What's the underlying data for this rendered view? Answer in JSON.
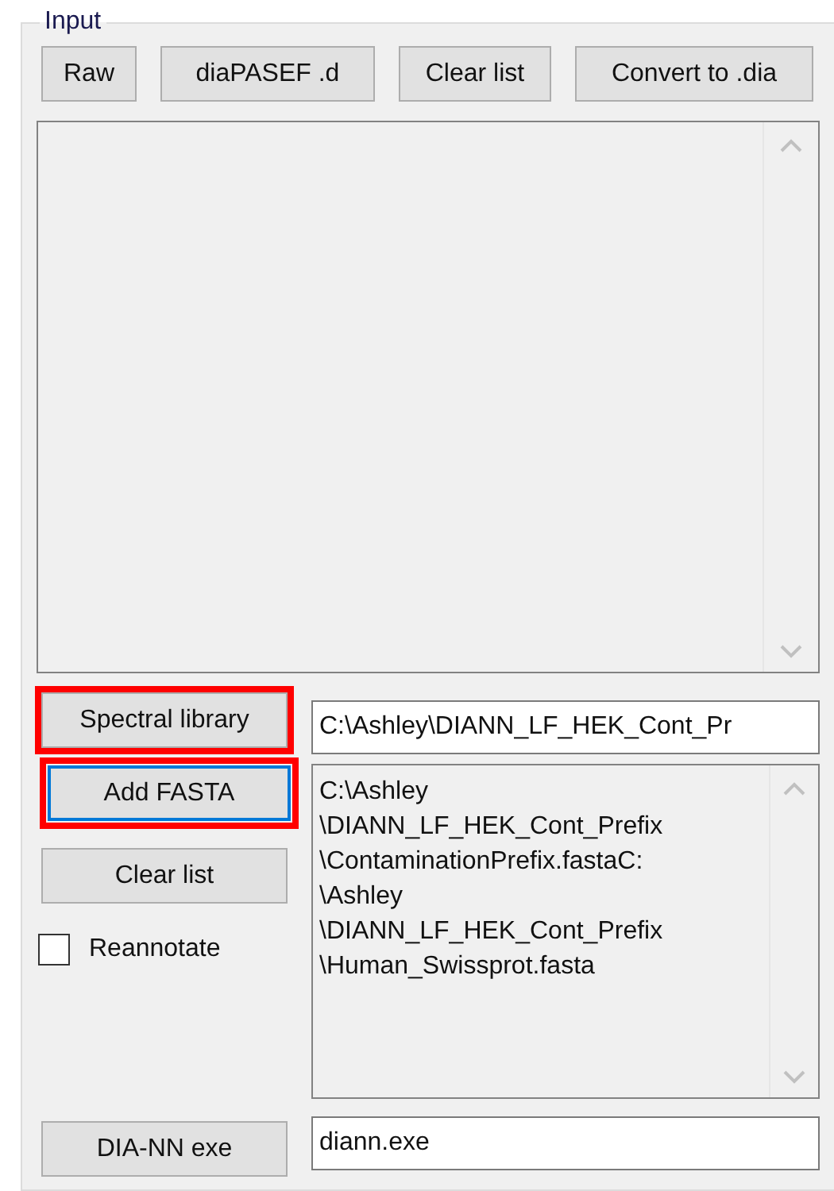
{
  "group": {
    "title": "Input"
  },
  "toolbar_buttons": [
    {
      "label": "Raw"
    },
    {
      "label": "diaPASEF .d"
    },
    {
      "label": "Clear list"
    },
    {
      "label": "Convert to .dia"
    }
  ],
  "spectral_library": {
    "button": {
      "label": "Spectral library",
      "highlighted": true,
      "focused": false
    },
    "path": "C:\\Ashley\\DIANN_LF_HEK_Cont_Pr"
  },
  "fasta": {
    "add_button": {
      "label": "Add FASTA",
      "highlighted": true,
      "focused": true
    },
    "clear_button": {
      "label": "Clear list",
      "highlighted": false,
      "focused": false
    },
    "files": [
      "C:\\Ashley",
      "\\DIANN_LF_HEK_Cont_Prefix",
      "\\ContaminationPrefix.fastaC:",
      "\\Ashley",
      "\\DIANN_LF_HEK_Cont_Prefix",
      "\\Human_Swissprot.fasta"
    ]
  },
  "reannotate": {
    "label": "Reannotate",
    "checked": false
  },
  "dia_nn_exe": {
    "button": {
      "label": "DIA-NN exe",
      "highlighted": false,
      "focused": false
    },
    "path": "diann.exe"
  }
}
